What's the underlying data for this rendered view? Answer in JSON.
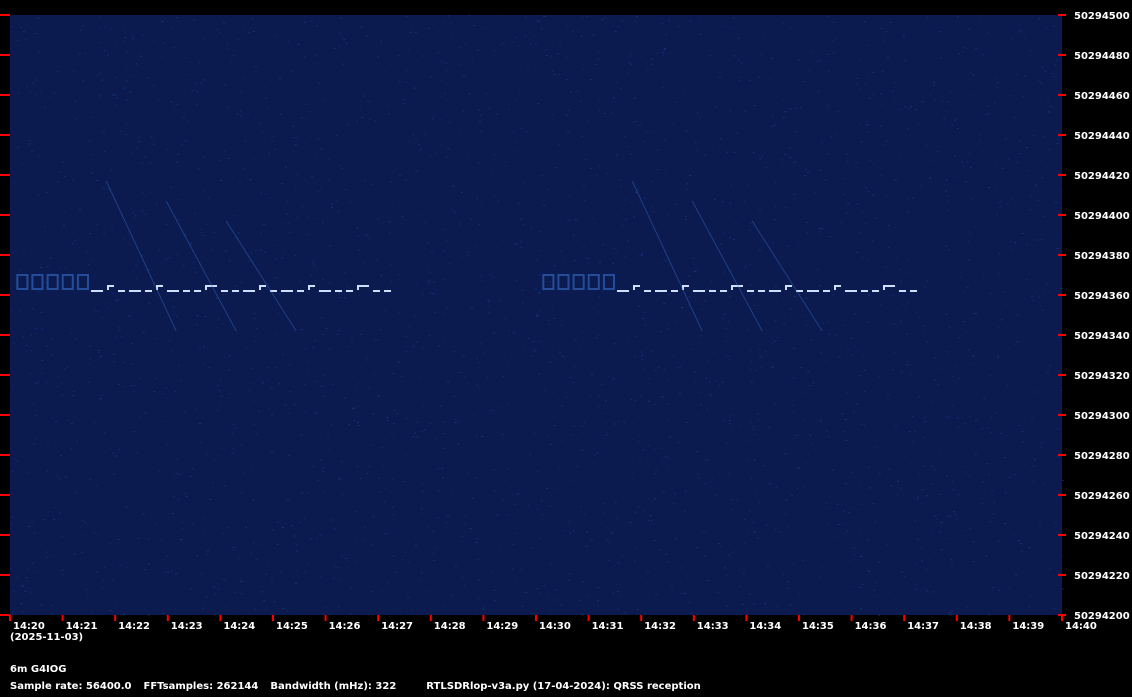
{
  "footer": {
    "date": "(2025-11-03)",
    "band": "6m G4IOG",
    "sample_rate": "Sample rate: 56400.0",
    "fft_samples": "FFTsamples: 262144",
    "bandwidth": "Bandwidth (mHz): 322",
    "program": "RTLSDRlop-v3a.py (17-04-2024): QRSS reception"
  },
  "colors": {
    "background": "#0b1a4f",
    "noise": "#1a3a8a",
    "signal": "#cfe0ff",
    "tick": "#ff0000",
    "text": "#ffffff"
  },
  "chart_data": {
    "type": "heatmap",
    "title": "",
    "xlabel": "",
    "ylabel": "",
    "x_ticks": [
      "14:20",
      "14:21",
      "14:22",
      "14:23",
      "14:24",
      "14:25",
      "14:26",
      "14:27",
      "14:28",
      "14:29",
      "14:30",
      "14:31",
      "14:32",
      "14:33",
      "14:34",
      "14:35",
      "14:36",
      "14:37",
      "14:38",
      "14:39",
      "14:40"
    ],
    "x_range_minutes": [
      0,
      20
    ],
    "y_ticks": [
      50294500,
      50294480,
      50294460,
      50294440,
      50294420,
      50294400,
      50294380,
      50294360,
      50294340,
      50294320,
      50294300,
      50294280,
      50294260,
      50294240,
      50294220,
      50294200
    ],
    "ylim": [
      50294200,
      50294500
    ],
    "signals": [
      {
        "start_minute": 0.1,
        "end_minute": 7.3,
        "center_hz": 50294362
      },
      {
        "start_minute": 10.1,
        "end_minute": 17.3,
        "center_hz": 50294362
      }
    ]
  }
}
